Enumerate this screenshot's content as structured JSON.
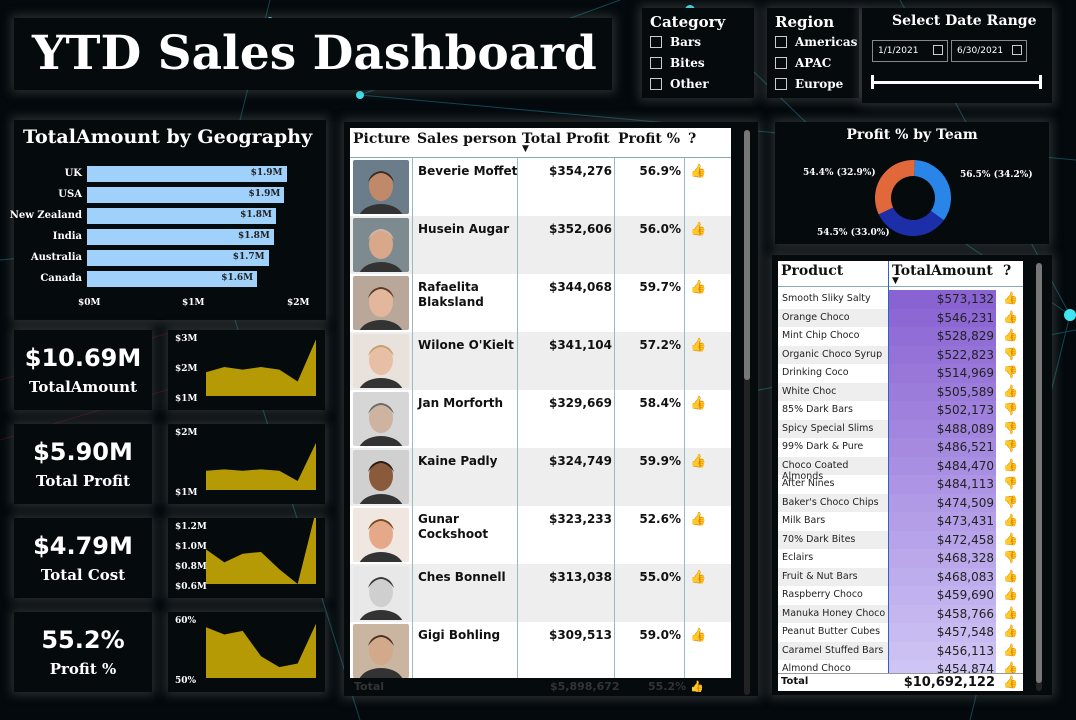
{
  "title": "YTD Sales Dashboard",
  "slicers": {
    "category": {
      "label": "Category",
      "options": [
        "Bars",
        "Bites",
        "Other"
      ]
    },
    "region": {
      "label": "Region",
      "options": [
        "Americas",
        "APAC",
        "Europe"
      ]
    },
    "date": {
      "label": "Select Date Range",
      "start": "1/1/2021",
      "end": "6/30/2021"
    }
  },
  "geography": {
    "title": "TotalAmount by Geography",
    "rows": [
      {
        "country": "UK",
        "label": "$1.9M",
        "value": 1.9
      },
      {
        "country": "USA",
        "label": "$1.9M",
        "value": 1.88
      },
      {
        "country": "New Zealand",
        "label": "$1.8M",
        "value": 1.8
      },
      {
        "country": "India",
        "label": "$1.8M",
        "value": 1.78
      },
      {
        "country": "Australia",
        "label": "$1.7M",
        "value": 1.73
      },
      {
        "country": "Canada",
        "label": "$1.6M",
        "value": 1.62
      }
    ],
    "axis": [
      "$0M",
      "$1M",
      "$2M"
    ],
    "max": 2.0
  },
  "kpis": [
    {
      "value": "$10.69M",
      "label": "TotalAmount",
      "ticks": [
        "$3M",
        "$2M",
        "$1M"
      ],
      "series": [
        1.9,
        2.1,
        2.0,
        2.1,
        2.0,
        1.55,
        3.15
      ],
      "min": 1.0,
      "max": 3.2
    },
    {
      "value": "$5.90M",
      "label": "Total Profit",
      "ticks": [
        "$2M",
        "$1M"
      ],
      "series": [
        0.98,
        1.02,
        0.98,
        1.02,
        0.98,
        0.7,
        1.75
      ],
      "min": 0.45,
      "max": 2.05
    },
    {
      "value": "$4.79M",
      "label": "Total Cost",
      "ticks": [
        "$1.2M",
        "$1.0M",
        "$0.8M",
        "$0.6M"
      ],
      "series": [
        0.95,
        0.8,
        0.9,
        0.92,
        0.72,
        0.55,
        1.4
      ],
      "min": 0.55,
      "max": 1.22
    },
    {
      "value": "55.2%",
      "label": "Profit %",
      "ticks": [
        "60%",
        "50%"
      ],
      "series": [
        61,
        59,
        60,
        53,
        50,
        51,
        62
      ],
      "min": 47,
      "max": 63
    }
  ],
  "sales_table": {
    "headers": {
      "picture": "Picture",
      "salesperson": "Sales person",
      "profit": "Total Profit",
      "pct": "Profit %",
      "q": "?"
    },
    "rows": [
      {
        "name": "Beverie Moffet",
        "profit": "$354,276",
        "pct": "56.9%",
        "skin": "#c08a6a",
        "hair": "#3a2a20",
        "bg": "#6b7d8a"
      },
      {
        "name": "Husein Augar",
        "profit": "$352,606",
        "pct": "56.0%",
        "skin": "#d9a88a",
        "hair": "#c9b9a6",
        "bg": "#7d8a8f"
      },
      {
        "name": "Rafaelita Blaksland",
        "profit": "$344,068",
        "pct": "59.7%",
        "skin": "#e3b79c",
        "hair": "#5a3a22",
        "bg": "#b9a89a"
      },
      {
        "name": "Wilone O'Kielt",
        "profit": "$341,104",
        "pct": "57.2%",
        "skin": "#e6bfa4",
        "hair": "#c7a070",
        "bg": "#e9e2dc"
      },
      {
        "name": "Jan Morforth",
        "profit": "$329,669",
        "pct": "58.4%",
        "skin": "#cdb3a0",
        "hair": "#6a6a6a",
        "bg": "#d6d6d6"
      },
      {
        "name": "Kaine Padly",
        "profit": "$324,749",
        "pct": "59.9%",
        "skin": "#8a5a3c",
        "hair": "#2a1a12",
        "bg": "#d0d0d0"
      },
      {
        "name": "Gunar Cockshoot",
        "profit": "$323,233",
        "pct": "52.6%",
        "skin": "#e5a98a",
        "hair": "#7a4a22",
        "bg": "#efe7e0"
      },
      {
        "name": "Ches Bonnell",
        "profit": "$313,038",
        "pct": "55.0%",
        "skin": "#cfcfcf",
        "hair": "#3a3a3a",
        "bg": "#e8e8e8"
      },
      {
        "name": "Gigi Bohling",
        "profit": "$309,513",
        "pct": "59.0%",
        "skin": "#d3a98c",
        "hair": "#4a3020",
        "bg": "#c9b5a0"
      }
    ],
    "total": {
      "label": "Total",
      "profit": "$5,898,672",
      "pct": "55.2%"
    }
  },
  "donut": {
    "title": "Profit % by Team",
    "slices": [
      {
        "label": "56.5% (34.2%)",
        "value": 34.2,
        "color": "#2a85e8"
      },
      {
        "label": "54.5% (33.0%)",
        "value": 33.0,
        "color": "#1c2fa8"
      },
      {
        "label": "54.4% (32.9%)",
        "value": 32.9,
        "color": "#e0683a"
      }
    ]
  },
  "product_table": {
    "headers": {
      "product": "Product",
      "amount": "TotalAmount",
      "q": "?"
    },
    "rows": [
      {
        "name": "Smooth Sliky Salty",
        "amount": "$573,132",
        "up": true
      },
      {
        "name": "Orange Choco",
        "amount": "$546,231",
        "up": true
      },
      {
        "name": "Mint Chip Choco",
        "amount": "$528,829",
        "up": true
      },
      {
        "name": "Organic Choco Syrup",
        "amount": "$522,823",
        "up": false
      },
      {
        "name": "Drinking Coco",
        "amount": "$514,969",
        "up": false
      },
      {
        "name": "White Choc",
        "amount": "$505,589",
        "up": true
      },
      {
        "name": "85% Dark Bars",
        "amount": "$502,173",
        "up": false
      },
      {
        "name": "Spicy Special Slims",
        "amount": "$488,089",
        "up": false
      },
      {
        "name": "99% Dark & Pure",
        "amount": "$486,521",
        "up": false
      },
      {
        "name": "Choco Coated Almonds",
        "amount": "$484,470",
        "up": true
      },
      {
        "name": "After Nines",
        "amount": "$484,113",
        "up": false
      },
      {
        "name": "Baker's Choco Chips",
        "amount": "$474,509",
        "up": false
      },
      {
        "name": "Milk Bars",
        "amount": "$473,431",
        "up": true
      },
      {
        "name": "70% Dark Bites",
        "amount": "$472,458",
        "up": true
      },
      {
        "name": "Eclairs",
        "amount": "$468,328",
        "up": false
      },
      {
        "name": "Fruit & Nut Bars",
        "amount": "$468,083",
        "up": true
      },
      {
        "name": "Raspberry Choco",
        "amount": "$459,690",
        "up": true
      },
      {
        "name": "Manuka Honey Choco",
        "amount": "$458,766",
        "up": true
      },
      {
        "name": "Peanut Butter Cubes",
        "amount": "$457,548",
        "up": true
      },
      {
        "name": "Caramel Stuffed Bars",
        "amount": "$456,113",
        "up": true
      },
      {
        "name": "Almond Choco",
        "amount": "$454,874",
        "up": true
      }
    ],
    "total": {
      "label": "Total",
      "amount": "$10,692,122"
    }
  },
  "colors": {
    "bar": "#9fd1fb",
    "spark": "#b59a05",
    "thumb": "#f2c12e",
    "grad_high": "#8a63d2",
    "grad_low": "#cfc5f5"
  }
}
